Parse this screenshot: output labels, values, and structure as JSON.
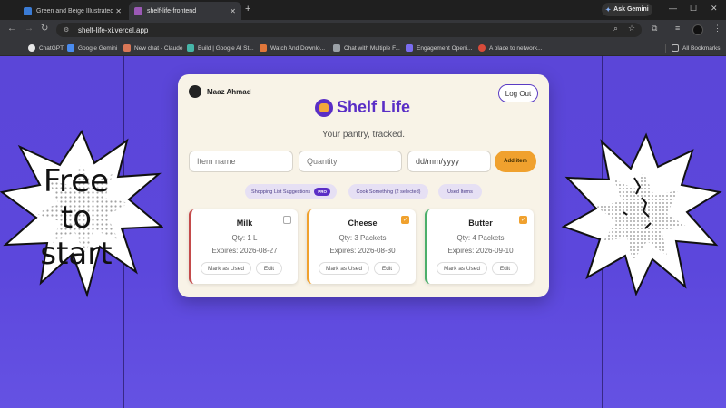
{
  "browser": {
    "tabs": [
      {
        "label": "Green and Beige Illustrated Gro",
        "active": false,
        "icon": "canva-icon"
      },
      {
        "label": "shelf-life-frontend",
        "active": true,
        "icon": "vercel-icon"
      }
    ],
    "ask_gemini": "Ask Gemini",
    "url": "shelf-life-xi.vercel.app",
    "bookmarks": [
      {
        "label": "ChatGPT",
        "color": "#e8e8e8"
      },
      {
        "label": "Google Gemini",
        "color": "#4a8cf0"
      },
      {
        "label": "New chat - Claude",
        "color": "#d97757"
      },
      {
        "label": "Build | Google AI St...",
        "color": "#46b5a8"
      },
      {
        "label": "Watch And Downlo...",
        "color": "#e0763a"
      },
      {
        "label": "Chat with Multiple F...",
        "color": "#9aa0a6"
      },
      {
        "label": "Engagement Openi...",
        "color": "#7a6cf0"
      },
      {
        "label": "A place to network...",
        "color": "#d84b3a"
      }
    ],
    "all_bookmarks": "All Bookmarks"
  },
  "promo": {
    "left_lines": [
      "Free",
      "to",
      "start"
    ]
  },
  "app": {
    "user_name": "Maaz Ahmad",
    "logout_label": "Log Out",
    "brand": "Shelf Life",
    "tagline": "Your pantry, tracked.",
    "inputs": {
      "name_placeholder": "Item name",
      "qty_placeholder": "Quantity",
      "date_value": "dd/mm/yyyy"
    },
    "add_label": "Add item",
    "actions": {
      "shopping": "Shopping List Suggestions",
      "pro_badge": "PRO",
      "cook": "Cook Something (2 selected)",
      "used": "Used Items"
    },
    "items": [
      {
        "name": "Milk",
        "qty": "Qty: 1 L",
        "expires": "Expires: 2026-08-27",
        "checked": false,
        "accent": "#c44a4a"
      },
      {
        "name": "Cheese",
        "qty": "Qty: 3 Packets",
        "expires": "Expires: 2026-08-30",
        "checked": true,
        "accent": "#f0a12e"
      },
      {
        "name": "Butter",
        "qty": "Qty: 4 Packets",
        "expires": "Expires: 2026-09-10",
        "checked": true,
        "accent": "#4caf6a"
      }
    ],
    "mark_used_label": "Mark as Used",
    "edit_label": "Edit"
  },
  "colors": {
    "brand_purple": "#5a2ec6",
    "accent_orange": "#f0a12e",
    "background_purple": "#5b46d8",
    "card_cream": "#f8f3e7"
  }
}
